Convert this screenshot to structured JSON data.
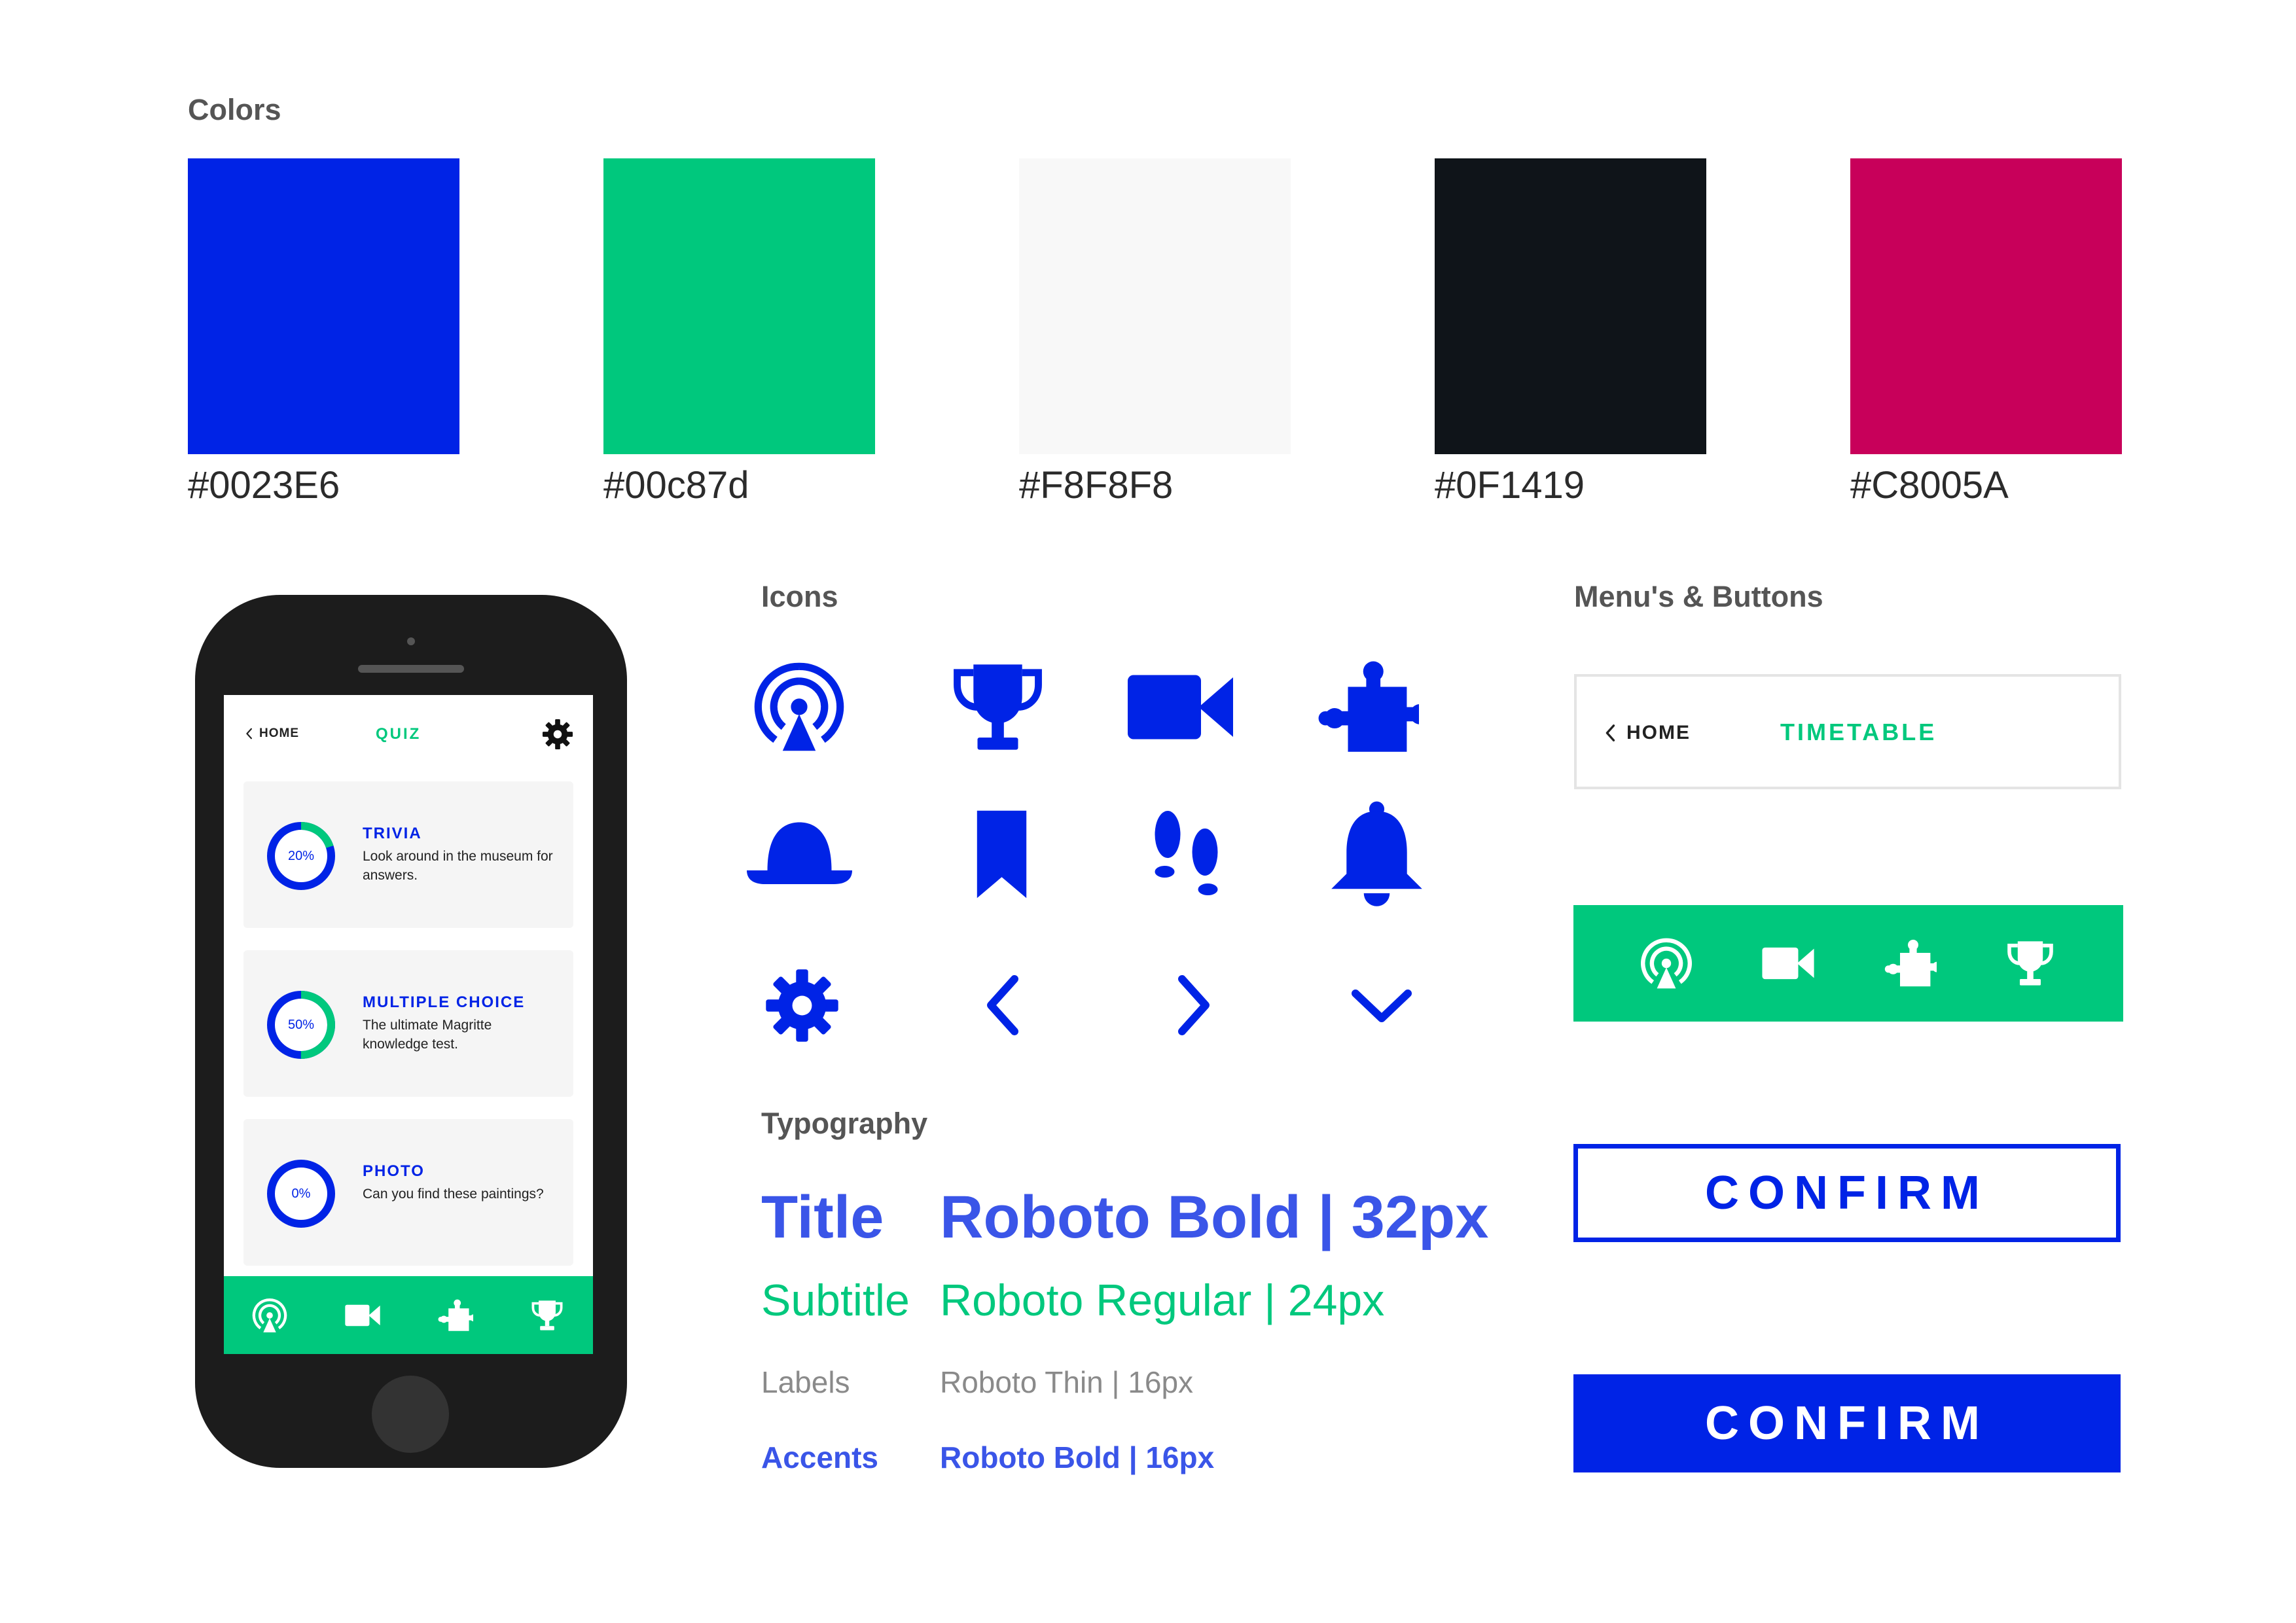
{
  "sections": {
    "colors": "Colors",
    "icons": "Icons",
    "menus": "Menu's & Buttons",
    "typography": "Typography"
  },
  "colors": [
    {
      "hex_label": "#0023E6",
      "value": "#0023E6"
    },
    {
      "hex_label": "#00c87d",
      "value": "#00c87d"
    },
    {
      "hex_label": "#F8F8F8",
      "value": "#F8F8F8"
    },
    {
      "hex_label": "#0F1419",
      "value": "#0F1419"
    },
    {
      "hex_label": "#C8005A",
      "value": "#C8005A"
    }
  ],
  "phone": {
    "header": {
      "back_label": "HOME",
      "title": "QUIZ"
    },
    "cards": [
      {
        "title": "TRIVIA",
        "desc": "Look around in the museum for answers.",
        "percent_label": "20%",
        "progress": 0.2
      },
      {
        "title": "MULTIPLE CHOICE",
        "desc": "The ultimate Magritte knowledge test.",
        "percent_label": "50%",
        "progress": 0.5
      },
      {
        "title": "PHOTO",
        "desc": "Can you find these paintings?",
        "percent_label": "0%",
        "progress": 0
      }
    ],
    "nav_icons": [
      "broadcast-icon",
      "video-camera-icon",
      "puzzle-icon",
      "trophy-icon"
    ]
  },
  "icons": [
    "broadcast-icon",
    "trophy-icon",
    "video-camera-icon",
    "puzzle-icon",
    "bowler-hat-icon",
    "bookmark-icon",
    "footprints-icon",
    "bell-icon",
    "gear-icon",
    "chevron-left-icon",
    "chevron-right-icon",
    "chevron-down-icon"
  ],
  "typography": {
    "title": {
      "key": "Title",
      "value": "Roboto Bold | 32px"
    },
    "subtitle": {
      "key": "Subtitle",
      "value": "Roboto Regular | 24px"
    },
    "labels": {
      "key": "Labels",
      "value": "Roboto Thin | 16px"
    },
    "accents": {
      "key": "Accents",
      "value": "Roboto Bold | 16px"
    }
  },
  "menus": {
    "menu_bar": {
      "back_label": "HOME",
      "title": "TIMETABLE"
    },
    "green_bar_icons": [
      "broadcast-icon",
      "video-camera-icon",
      "puzzle-icon",
      "trophy-icon"
    ],
    "button_outline": "CONFIRM",
    "button_solid": "CONFIRM"
  },
  "theme": {
    "primary": "#0023E6",
    "accent": "#00c87d",
    "light": "#F8F8F8",
    "dark": "#0F1419",
    "secondary": "#C8005A"
  }
}
